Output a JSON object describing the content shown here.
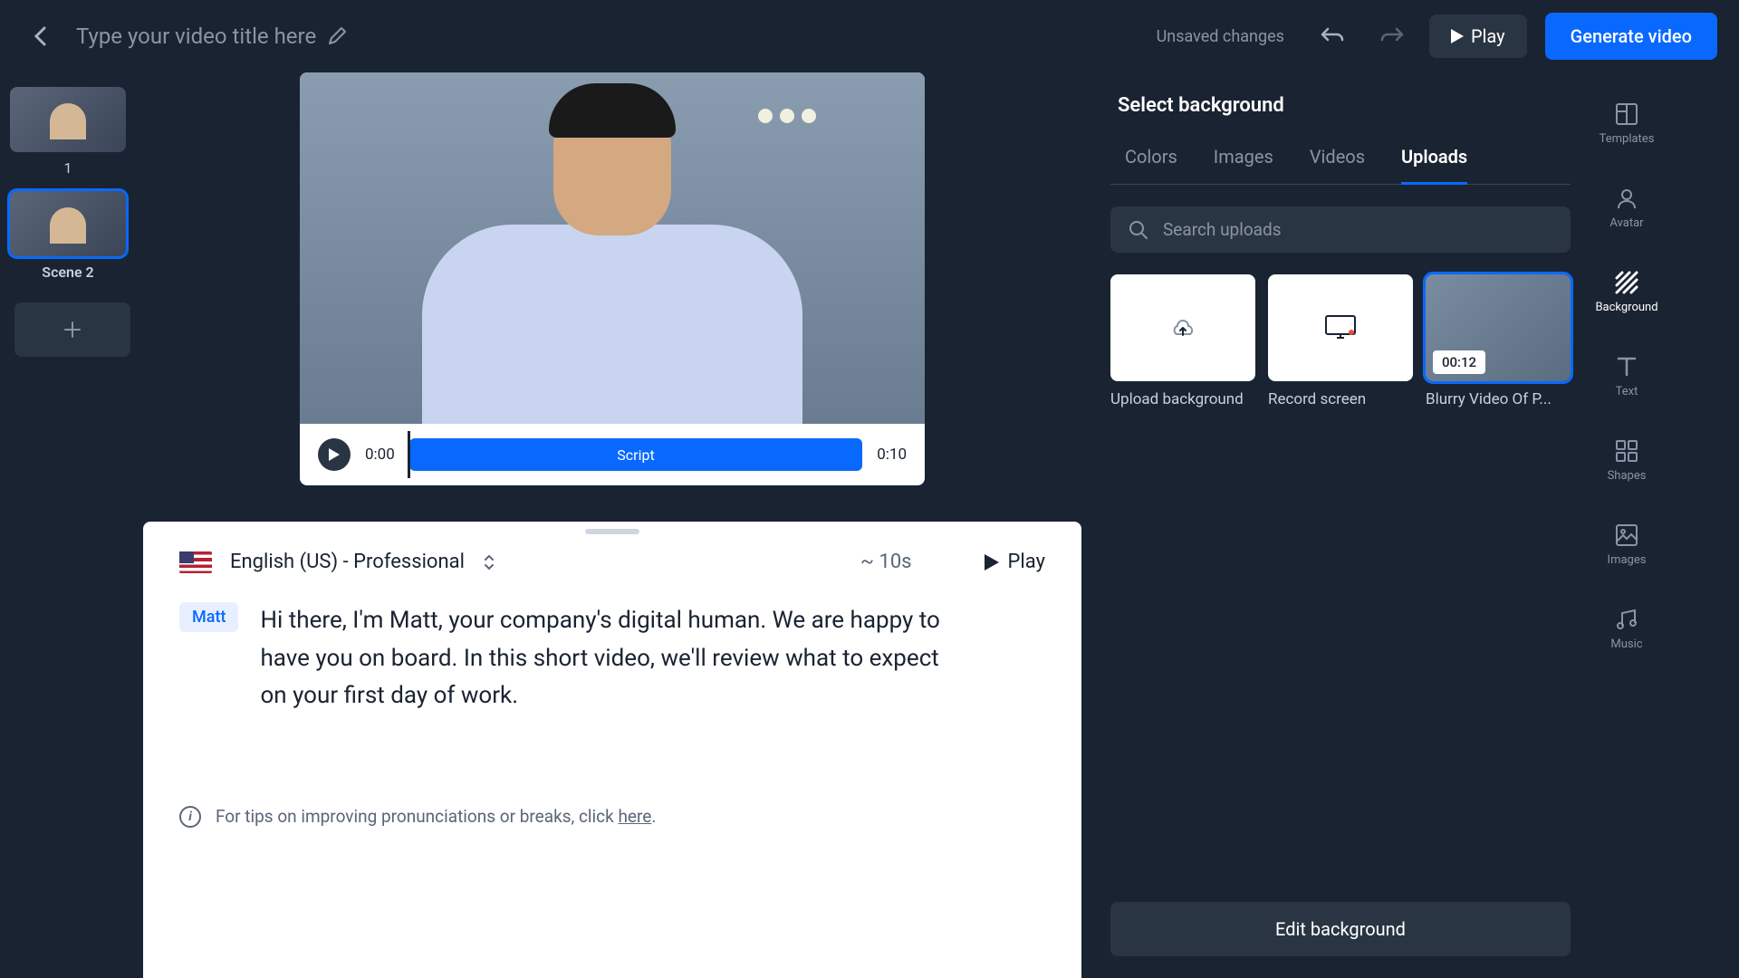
{
  "topbar": {
    "title_placeholder": "Type your video title here",
    "unsaved": "Unsaved changes",
    "play": "Play",
    "generate": "Generate video"
  },
  "scenes": {
    "items": [
      {
        "label": "1"
      },
      {
        "label": "Scene 2"
      }
    ]
  },
  "timeline": {
    "current": "0:00",
    "track_label": "Script",
    "total": "0:10"
  },
  "script": {
    "language": "English (US) - Professional",
    "duration": "~ 10s",
    "play": "Play",
    "speaker": "Matt",
    "text": "Hi there, I'm Matt, your company's digital human.  We are happy to have you on board. In this short video, we'll review what to expect on your first day of work.",
    "tips_prefix": "For tips on improving pronunciations or breaks, click ",
    "tips_link": "here"
  },
  "side": {
    "title": "Select background",
    "tabs": [
      "Colors",
      "Images",
      "Videos",
      "Uploads"
    ],
    "active_tab": 3,
    "search_placeholder": "Search uploads",
    "cards": {
      "upload": "Upload background",
      "record": "Record screen",
      "item_label": "Blurry Video Of P...",
      "item_duration": "00:12"
    },
    "edit_btn": "Edit background"
  },
  "rail": {
    "items": [
      "Templates",
      "Avatar",
      "Background",
      "Text",
      "Shapes",
      "Images",
      "Music"
    ],
    "active": 2
  }
}
